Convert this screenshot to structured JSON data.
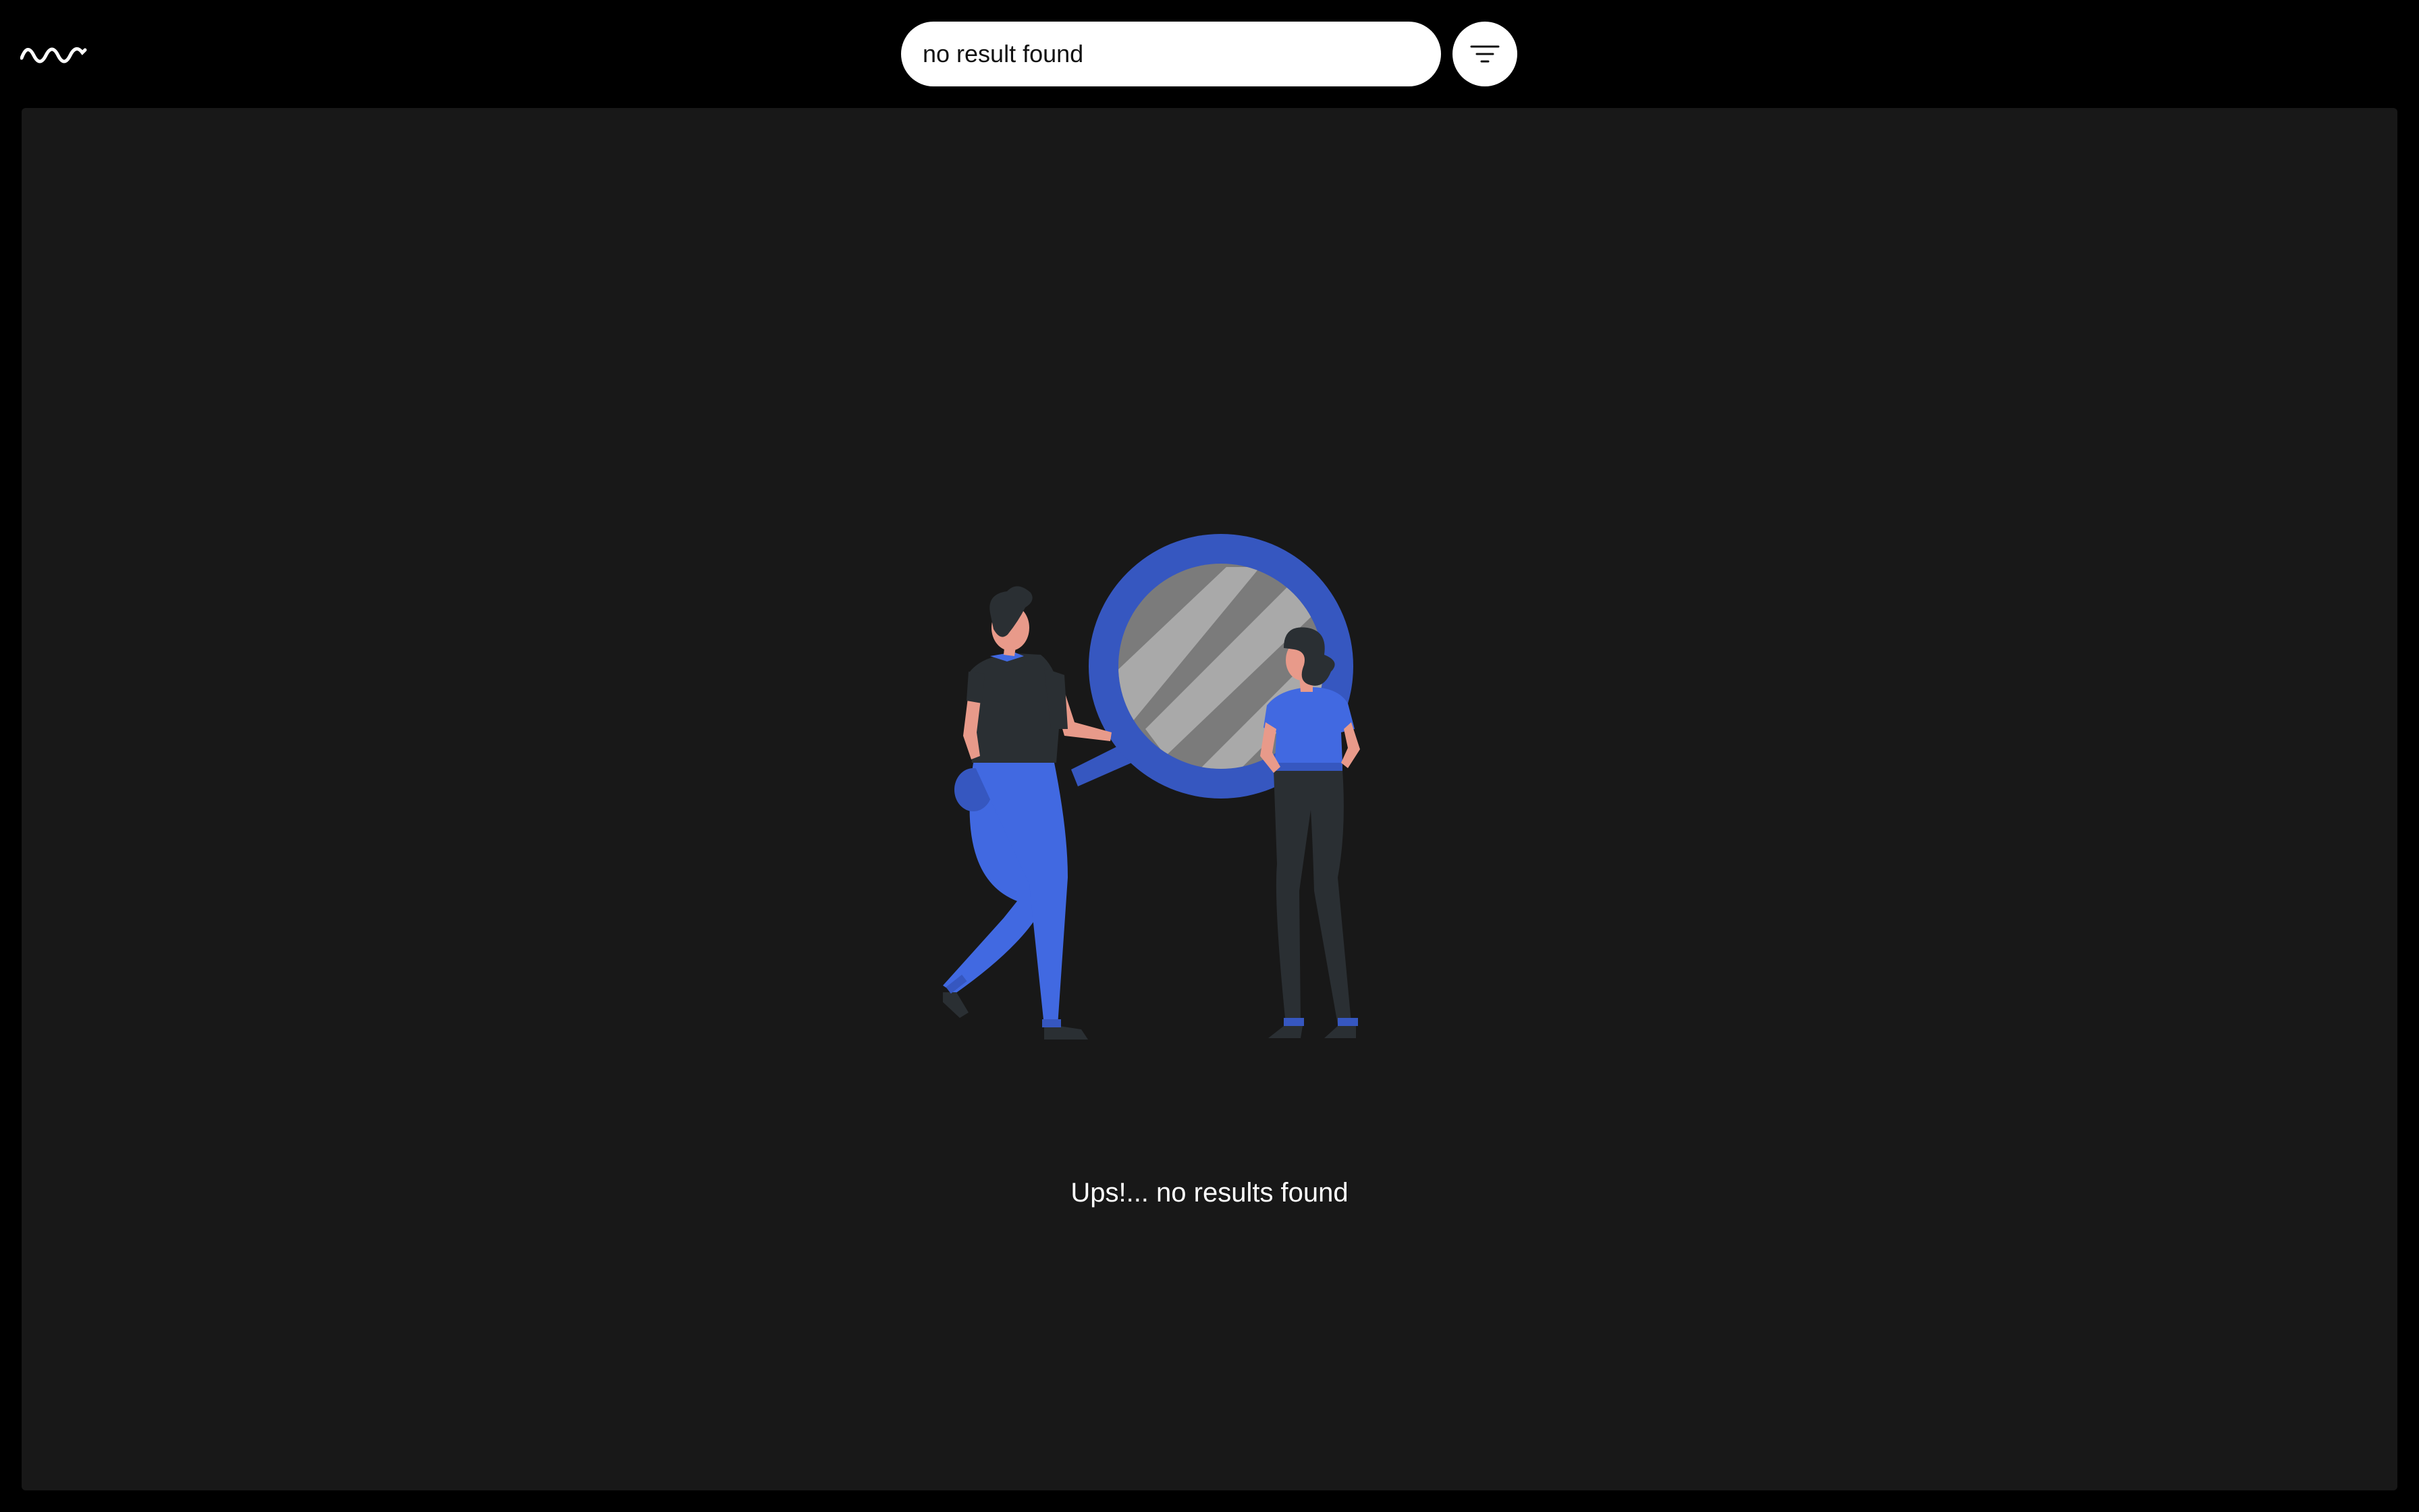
{
  "header": {
    "logo_icon": "wave-logo-icon",
    "search": {
      "value": "no result found",
      "placeholder": ""
    },
    "filter_icon": "filter-lines-icon"
  },
  "main": {
    "illustration": "people-with-magnifying-glass-illustration",
    "empty_message": "Ups!... no results found"
  },
  "colors": {
    "background": "#000000",
    "panel": "#181818",
    "accent_blue": "#4169e1",
    "dark_blue": "#3657c0",
    "skin": "#e89a8a",
    "dark_clothing": "#2a2f33"
  }
}
